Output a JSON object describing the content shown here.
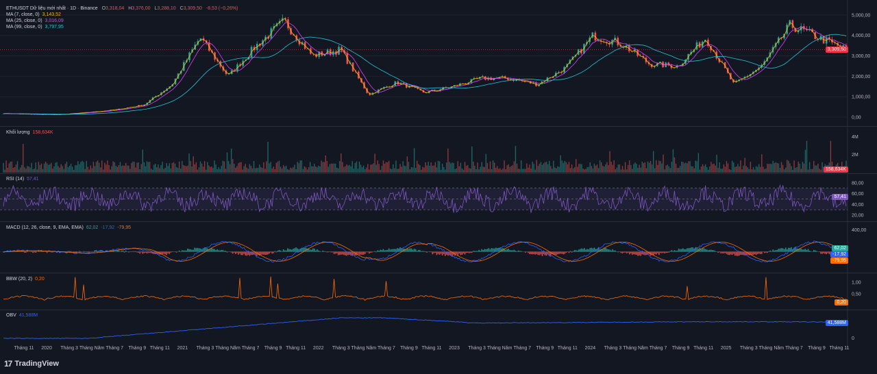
{
  "header": {
    "symbol": "ETHUSDT Dữ liệu mới nhất · 1D · Binance",
    "o_label": "O",
    "o": "3,318,04",
    "h_label": "H",
    "h": "3,376,00",
    "l_label": "L",
    "l": "3,288,10",
    "c_label": "C",
    "c": "3,309,50",
    "change": "-8,53 (−0,26%)"
  },
  "ma": [
    {
      "label": "MA (7, close, 0)",
      "value": "3,143,52",
      "color": "#ffb300"
    },
    {
      "label": "MA (25, close, 0)",
      "value": "3,016,09",
      "color": "#e040fb"
    },
    {
      "label": "MA (99, close, 0)",
      "value": "3,797,95",
      "color": "#26c6da"
    }
  ],
  "panels": {
    "volume": {
      "label": "Khối lượng",
      "value": "158,634K",
      "badge": "158,634K"
    },
    "rsi": {
      "label": "RSI (14)",
      "value": "57,41",
      "badge": "57,41"
    },
    "macd": {
      "label": "MACD (12, 26, close, 9, EMA, EMA)",
      "v1": "62,02",
      "v2": "-17,92",
      "v3": "-79,95"
    },
    "bbw": {
      "label": "BBW (20, 2)",
      "value": "0,20",
      "badge": "0,20"
    },
    "obv": {
      "label": "OBV",
      "value": "41,588M",
      "badge": "41,588M"
    }
  },
  "price_badge": "3,309,50",
  "colors": {
    "bg": "#131722",
    "up": "#26a69a",
    "down": "#ef5350",
    "rsi": "#7e57c2",
    "macd": "#2962ff",
    "signal": "#ff6d00",
    "bbw": "#ff6d00",
    "obv": "#2962ff",
    "price_badge": "#f23645"
  },
  "brand": "TradingView",
  "chart_data": [
    {
      "type": "line",
      "title": "ETHUSDT Dữ liệu mới nhất · 1D · Binance",
      "series": [
        {
          "name": "ETHUSDT",
          "x": [
            "2019-10",
            "2020-01",
            "2020-03",
            "2020-06",
            "2020-09",
            "2020-12",
            "2021-02",
            "2021-05",
            "2021-07",
            "2021-09",
            "2021-11",
            "2022-01",
            "2022-04",
            "2022-06",
            "2022-08",
            "2022-11",
            "2023-01",
            "2023-04",
            "2023-07",
            "2023-10",
            "2024-01",
            "2024-03",
            "2024-06",
            "2024-08",
            "2024-10",
            "2024-12",
            "2025-03",
            "2025-05",
            "2025-08",
            "2025-10",
            "2025-11"
          ],
          "values": [
            180,
            140,
            120,
            230,
            360,
            600,
            1600,
            3900,
            2000,
            3500,
            4700,
            3000,
            3300,
            1100,
            1700,
            1200,
            1500,
            1900,
            1900,
            1600,
            2400,
            4000,
            3600,
            2600,
            2500,
            3900,
            1600,
            2500,
            4500,
            3900,
            3309
          ]
        }
      ],
      "yticks": [
        "5,000,00",
        "4,000,00",
        "3,000,00",
        "2,000,00",
        "1,000,00",
        "0,00"
      ],
      "ylim": [
        0,
        5500
      ]
    },
    {
      "type": "bar",
      "title": "Khối lượng",
      "yticks": [
        "4M",
        "2M"
      ]
    },
    {
      "type": "line",
      "title": "RSI (14)",
      "yticks": [
        "80,00",
        "60,00",
        "40,00",
        "20,00"
      ],
      "ylim": [
        15,
        90
      ]
    },
    {
      "type": "line",
      "title": "MACD (12, 26, close, 9, EMA, EMA)",
      "yticks": [
        "400,00"
      ]
    },
    {
      "type": "line",
      "title": "BBW (20, 2)",
      "yticks": [
        "1,00",
        "0,50"
      ],
      "ylim": [
        0,
        1.3
      ]
    },
    {
      "type": "line",
      "title": "OBV",
      "yticks": [
        "0"
      ]
    }
  ],
  "xaxis": [
    "Tháng 11",
    "2020",
    "Tháng 3",
    "Tháng Năm",
    "Tháng 7",
    "Tháng 9",
    "Tháng 11",
    "2021",
    "Tháng 3",
    "Tháng Năm",
    "Tháng 7",
    "Tháng 9",
    "Tháng 11",
    "2022",
    "Tháng 3",
    "Tháng Năm",
    "Tháng 7",
    "Tháng 9",
    "Tháng 11",
    "2023",
    "Tháng 3",
    "Tháng Năm",
    "Tháng 7",
    "Tháng 9",
    "Tháng 11",
    "2024",
    "Tháng 3",
    "Tháng Năm",
    "Tháng 7",
    "Tháng 9",
    "Tháng 11",
    "2025",
    "Tháng 3",
    "Tháng Năm",
    "Tháng 7",
    "Tháng 9",
    "Tháng 11"
  ]
}
